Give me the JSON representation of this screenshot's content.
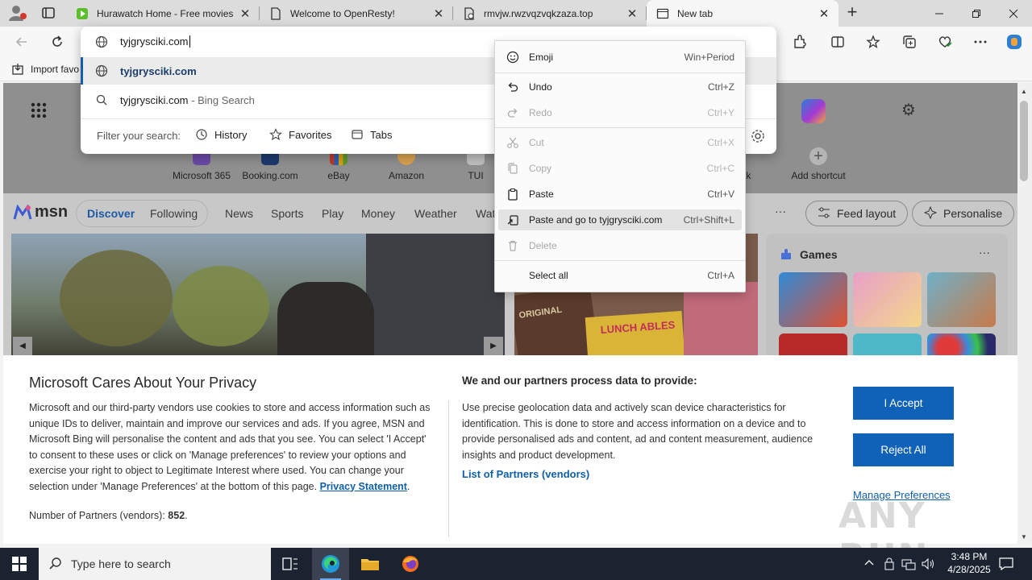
{
  "browser": {
    "tabs": [
      {
        "title": "Hurawatch Home - Free movies",
        "icon": "hurawatch-favicon"
      },
      {
        "title": "Welcome to OpenResty!",
        "icon": "page-icon"
      },
      {
        "title": "rmvjw.rwzvqzvqkzaza.top",
        "icon": "broken-page-icon"
      },
      {
        "title": "New tab",
        "icon": "newtab-icon"
      }
    ],
    "new_tab_symbol": "+",
    "address_value": "tyjgrysciki.com",
    "favorites_bar_item": "Import favo"
  },
  "omnibox": {
    "suggestions": [
      {
        "text": "tyjgrysciki.com",
        "sub": ""
      },
      {
        "text": "tyjgrysciki.com",
        "sub": " - Bing Search"
      }
    ],
    "filter_label": "Filter your search:",
    "filters": [
      "History",
      "Favorites",
      "Tabs"
    ]
  },
  "context_menu": {
    "items": [
      {
        "label": "Emoji",
        "shortcut": "Win+Period"
      },
      {
        "label": "Undo",
        "shortcut": "Ctrl+Z"
      },
      {
        "label": "Redo",
        "shortcut": "Ctrl+Y"
      },
      {
        "label": "Cut",
        "shortcut": "Ctrl+X"
      },
      {
        "label": "Copy",
        "shortcut": "Ctrl+C"
      },
      {
        "label": "Paste",
        "shortcut": "Ctrl+V"
      },
      {
        "label": "Paste and go to tyjgrysciki.com",
        "shortcut": "Ctrl+Shift+L"
      },
      {
        "label": "Delete",
        "shortcut": ""
      },
      {
        "label": "Select all",
        "shortcut": "Ctrl+A"
      }
    ]
  },
  "newtab": {
    "shortcuts": [
      "Microsoft 365",
      "Booking.com",
      "eBay",
      "Amazon",
      "TUI",
      "tlook",
      "Add shortcut"
    ],
    "msn": {
      "logo": "msn",
      "nav": [
        "Discover",
        "Following",
        "News",
        "Sports",
        "Play",
        "Money",
        "Weather",
        "Wat"
      ],
      "more": "···",
      "feed_layout": "Feed layout",
      "personalise": "Personalise"
    },
    "games_title": "Games",
    "games_more": "···",
    "card_texts": [
      "ORIGINAL",
      "LUNCH ABLES"
    ]
  },
  "privacy": {
    "title": "Microsoft Cares About Your Privacy",
    "body": "Microsoft and our third-party vendors use cookies to store and access information such as unique IDs to deliver, maintain and improve our services and ads. If you agree, MSN and Microsoft Bing will personalise the content and ads that you see. You can select 'I Accept' to consent to these uses or click on 'Manage preferences' to review your options and exercise your right to object to Legitimate Interest where used.  You can change your selection under 'Manage Preferences' at the bottom of this page.",
    "privacy_link": "Privacy Statement",
    "partners_label": "Number of Partners (vendors): ",
    "partners_count": "852",
    "data_heading": "We and our partners process data to provide:",
    "data_body": "Use precise geolocation data and actively scan device characteristics for identification. This is done to store and access information on a device and to provide personalised ads and content, ad and content measurement, audience insights and product development.",
    "partners_link": "List of Partners (vendors)",
    "accept": "I Accept",
    "reject": "Reject All",
    "manage": "Manage Preferences"
  },
  "watermark": "ANY RUN",
  "taskbar": {
    "search_placeholder": "Type here to search",
    "time": "3:48 PM",
    "date": "4/28/2025"
  },
  "colors": {
    "accent": "#0f62b8",
    "link": "#0f5fa8",
    "taskbar": "#1b2230"
  }
}
